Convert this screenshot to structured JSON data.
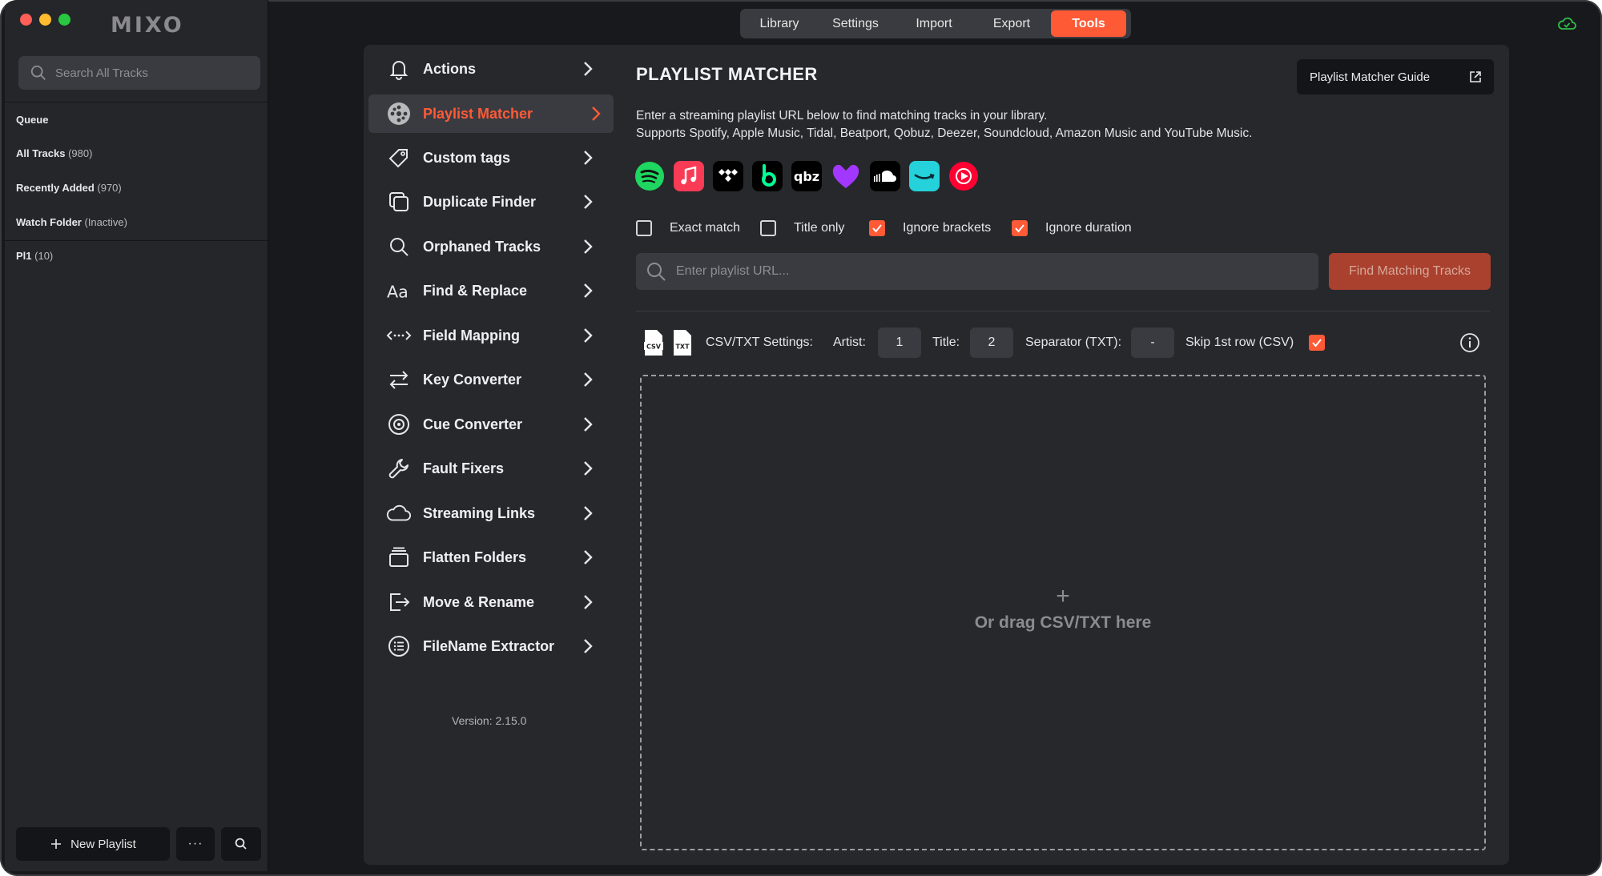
{
  "app": {
    "logo": "MIXO"
  },
  "sidebar": {
    "search_placeholder": "Search All Tracks",
    "items": [
      {
        "label": "Queue",
        "count": ""
      },
      {
        "label": "All Tracks",
        "count": "(980)"
      },
      {
        "label": "Recently Added",
        "count": "(970)"
      },
      {
        "label": "Watch Folder",
        "count": "(Inactive)"
      },
      {
        "label": "Pl1",
        "count": "(10)"
      }
    ],
    "new_playlist_label": "New Playlist",
    "more_label": "···"
  },
  "tabs": [
    {
      "label": "Library",
      "active": false
    },
    {
      "label": "Settings",
      "active": false
    },
    {
      "label": "Import",
      "active": false
    },
    {
      "label": "Export",
      "active": false
    },
    {
      "label": "Tools",
      "active": true
    }
  ],
  "tools_menu": {
    "items": [
      {
        "label": "Actions",
        "icon": "bell-icon"
      },
      {
        "label": "Playlist Matcher",
        "icon": "vinyl-icon",
        "active": true
      },
      {
        "label": "Custom tags",
        "icon": "tag-icon"
      },
      {
        "label": "Duplicate Finder",
        "icon": "copy-icon"
      },
      {
        "label": "Orphaned Tracks",
        "icon": "search-icon"
      },
      {
        "label": "Find & Replace",
        "icon": "font-icon"
      },
      {
        "label": "Field Mapping",
        "icon": "arrows-horizontal-icon"
      },
      {
        "label": "Key Converter",
        "icon": "swap-icon"
      },
      {
        "label": "Cue Converter",
        "icon": "target-icon"
      },
      {
        "label": "Fault Fixers",
        "icon": "wrench-icon"
      },
      {
        "label": "Streaming Links",
        "icon": "cloud-icon"
      },
      {
        "label": "Flatten Folders",
        "icon": "folders-icon"
      },
      {
        "label": "Move & Rename",
        "icon": "export-icon"
      },
      {
        "label": "FileName Extractor",
        "icon": "list-icon"
      }
    ],
    "version": "Version: 2.15.0"
  },
  "matcher": {
    "title": "PLAYLIST MATCHER",
    "guide_label": "Playlist Matcher Guide",
    "description_line1": "Enter a streaming playlist URL below to find matching tracks in your library.",
    "description_line2": "Supports Spotify, Apple Music, Tidal, Beatport, Qobuz, Deezer, Soundcloud, Amazon Music and YouTube Music.",
    "services": [
      "spotify-icon",
      "apple-music-icon",
      "tidal-icon",
      "beatport-icon",
      "qobuz-icon",
      "deezer-icon",
      "soundcloud-icon",
      "amazon-music-icon",
      "youtube-music-icon"
    ],
    "qobuz_text": "qbz",
    "options": [
      {
        "label": "Exact match",
        "checked": false
      },
      {
        "label": "Title only",
        "checked": false
      },
      {
        "label": "Ignore brackets",
        "checked": true
      },
      {
        "label": "Ignore duration",
        "checked": true
      }
    ],
    "url_placeholder": "Enter playlist URL...",
    "find_label": "Find Matching Tracks",
    "csv": {
      "csv_badge": "CSV",
      "txt_badge": "TXT",
      "settings_label": "CSV/TXT Settings:",
      "artist_label": "Artist:",
      "artist_value": "1",
      "title_label": "Title:",
      "title_value": "2",
      "separator_label": "Separator (TXT):",
      "separator_value": "-",
      "skip_label": "Skip 1st row (CSV)",
      "skip_checked": true
    },
    "drop_plus": "+",
    "drop_text": "Or drag CSV/TXT here"
  },
  "colors": {
    "accent": "#ff5a36",
    "background": "#18191c",
    "panel": "#27282c"
  }
}
